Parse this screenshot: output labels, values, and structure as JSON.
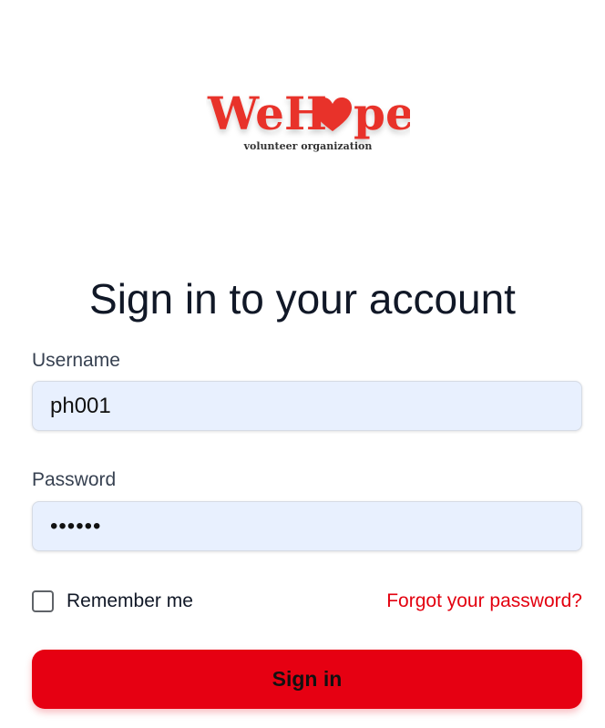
{
  "logo": {
    "word_left": "WeH",
    "word_right": "pe",
    "tagline": "volunteer organization",
    "brand_color": "#e8332a",
    "heart_icon": "heart-icon"
  },
  "heading": "Sign in to your account",
  "form": {
    "username_label": "Username",
    "username_value": "ph001",
    "password_label": "Password",
    "password_value": "••••••",
    "remember_label": "Remember me",
    "forgot_link": "Forgot your password?",
    "submit_label": "Sign in"
  },
  "colors": {
    "accent": "#e60012",
    "input_bg": "#e8f0fe",
    "link": "#e3000f"
  }
}
